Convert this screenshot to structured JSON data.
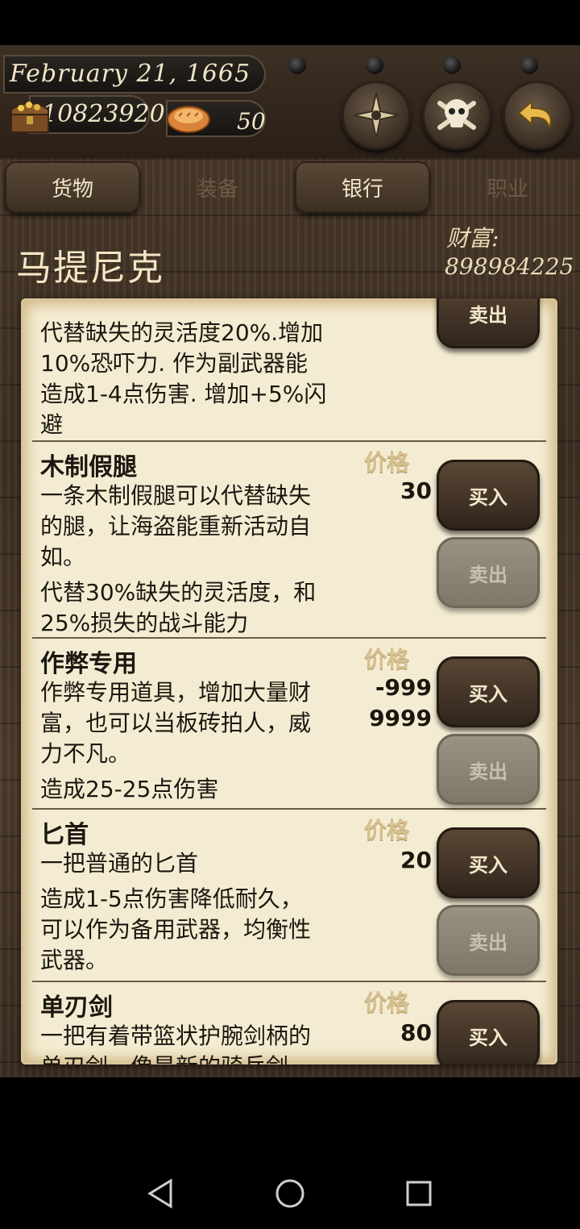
{
  "header": {
    "date": "February 21, 1665",
    "gold": "10823920",
    "bread": "50",
    "icons": {
      "chest": "treasure-chest-icon",
      "bread": "bread-icon",
      "compass": "compass-icon",
      "skull": "skull-crossbones-icon",
      "back": "back-arrow-icon"
    }
  },
  "tabs": [
    {
      "label": "货物",
      "active": true
    },
    {
      "label": "装备",
      "active": false
    },
    {
      "label": "银行",
      "active": true
    },
    {
      "label": "职业",
      "active": false
    }
  ],
  "location": {
    "name": "马提尼克",
    "wealth_label": "财富:",
    "wealth_value": "898984225"
  },
  "price_label": "价格",
  "buy_label": "买入",
  "sell_label": "卖出",
  "items": [
    {
      "name": "",
      "desc": [
        "代替缺失的灵活度20%.增加",
        "10%恐吓力. 作为副武器能",
        "造成1-4点伤害. 增加+5%闪",
        "避"
      ],
      "price": []
    },
    {
      "name": "木制假腿",
      "desc": [
        "一条木制假腿可以代替缺失",
        "的腿，让海盗能重新活动自",
        "如。",
        "代替30%缺失的灵活度，和",
        "25%损失的战斗能力"
      ],
      "price": [
        "30"
      ]
    },
    {
      "name": "作弊专用",
      "desc": [
        "作弊专用道具，增加大量财",
        "富，也可以当板砖拍人，威",
        "力不凡。",
        "造成25-25点伤害"
      ],
      "price": [
        "-999",
        "9999"
      ]
    },
    {
      "name": "匕首",
      "desc": [
        "一把普通的匕首",
        "造成1-5点伤害降低耐久，",
        "可以作为备用武器，均衡性",
        "武器。"
      ],
      "price": [
        "20"
      ]
    },
    {
      "name": "单刃剑",
      "desc": [
        "一把有着带篮状护腕剑柄的",
        "单刃剑，像是新的骑兵剑"
      ],
      "price": [
        "80"
      ]
    }
  ]
}
